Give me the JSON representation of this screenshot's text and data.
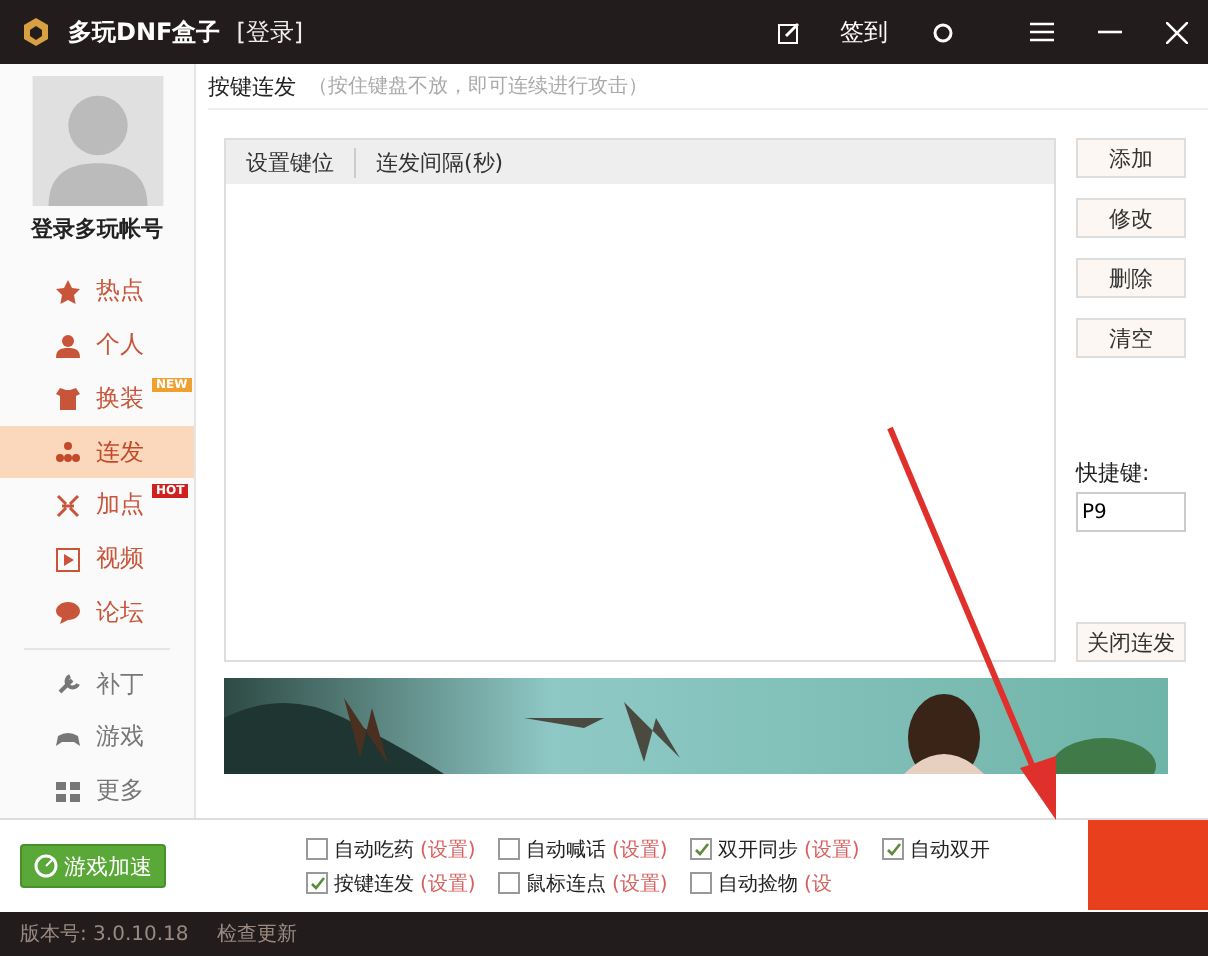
{
  "window": {
    "title": "多玩DNF盒子",
    "login_link": "[登录]",
    "checkin": "签到"
  },
  "sidebar": {
    "account": "登录多玩帐号",
    "items": [
      {
        "label": "热点",
        "selected": false
      },
      {
        "label": "个人",
        "selected": false
      },
      {
        "label": "换装",
        "selected": false,
        "badge": "NEW"
      },
      {
        "label": "连发",
        "selected": true
      },
      {
        "label": "加点",
        "selected": false,
        "badge": "HOT"
      },
      {
        "label": "视频",
        "selected": false
      },
      {
        "label": "论坛",
        "selected": false
      }
    ],
    "tools": [
      {
        "label": "补丁"
      },
      {
        "label": "游戏"
      },
      {
        "label": "更多"
      }
    ]
  },
  "panel": {
    "title": "按键连发",
    "hint": "（按住键盘不放，即可连续进行攻击）",
    "columns": [
      "设置键位",
      "连发间隔(秒)"
    ],
    "buttons": [
      "添加",
      "修改",
      "删除",
      "清空"
    ],
    "hotkey_label": "快捷键:",
    "hotkey_value": "P9",
    "close_button": "关闭连发"
  },
  "accelerate_button": "游戏加速",
  "options": [
    {
      "label": "自动吃药",
      "link": "(设置)",
      "checked": false
    },
    {
      "label": "自动喊话",
      "link": "(设置)",
      "checked": false
    },
    {
      "label": "双开同步",
      "link": "(设置)",
      "checked": true
    },
    {
      "label": "自动双开",
      "checked": true
    },
    {
      "label": "按键连发",
      "link": "(设置)",
      "checked": true
    },
    {
      "label": "鼠标连点",
      "link": "(设置)",
      "checked": false
    },
    {
      "label": "自动捡物",
      "link": "(设",
      "checked": false
    }
  ],
  "status_bar": {
    "version": "版本号: 3.0.10.18",
    "update_link": "检查更新"
  }
}
